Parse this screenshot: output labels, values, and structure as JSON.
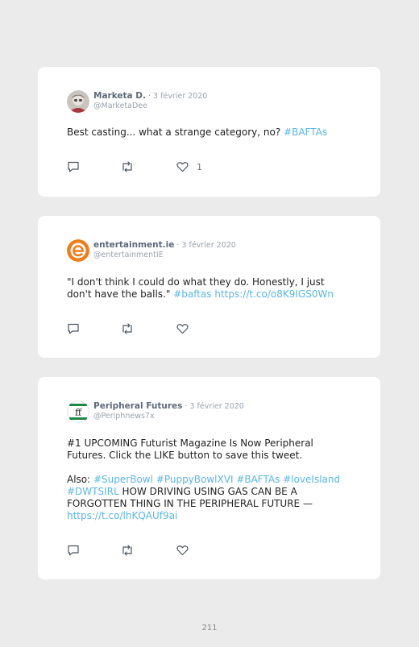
{
  "tweets": [
    {
      "name": "Marketa D.",
      "date": " · 3 février 2020",
      "handle": "@MarketaDee",
      "avatar_icon": "user-photo-avatar",
      "paragraphs": [
        [
          {
            "t": "Best casting... what a strange category, no? ",
            "link": false
          },
          {
            "t": "#BAFTAs",
            "link": true
          }
        ]
      ],
      "like_count": "1"
    },
    {
      "name": "entertainment.ie",
      "date": " · 3 février 2020",
      "handle": "@entertainmentIE",
      "avatar_icon": "entertainment-ie-logo",
      "paragraphs": [
        [
          {
            "t": "\"I don't think I could do what they do. Honestly, I just don't have the balls.\" ",
            "link": false
          },
          {
            "t": "#baftas",
            "link": true
          },
          {
            "t": " ",
            "link": false
          },
          {
            "t": "https://t.co/o8K9IGS0Wn",
            "link": true
          }
        ]
      ],
      "like_count": ""
    },
    {
      "name": "Peripheral Futures",
      "date": " · 3 février 2020",
      "handle": "@Periphnews7x",
      "avatar_icon": "peripheral-futures-logo",
      "paragraphs": [
        [
          {
            "t": "#1 UPCOMING Futurist Magazine Is Now Peripheral Futures. Click the LIKE button to save this tweet.",
            "link": false
          }
        ],
        [
          {
            "t": "Also: ",
            "link": false
          },
          {
            "t": "#SuperBowl",
            "link": true
          },
          {
            "t": " ",
            "link": false
          },
          {
            "t": "#PuppyBowlXVI",
            "link": true
          },
          {
            "t": " ",
            "link": false
          },
          {
            "t": "#BAFTAs",
            "link": true
          },
          {
            "t": " ",
            "link": false
          },
          {
            "t": "#loveIsland",
            "link": true
          },
          {
            "t": " ",
            "link": false
          },
          {
            "t": "#DWTSIRL",
            "link": true
          },
          {
            "t": " HOW DRIVING USING GAS CAN BE A FORGOTTEN THING IN THE PERIPHERAL FUTURE — ",
            "link": false
          },
          {
            "t": "https://t.co/lhKQAUf9ai",
            "link": true
          }
        ]
      ],
      "like_count": ""
    }
  ],
  "icons": {
    "reply": "reply-icon",
    "retweet": "retweet-icon",
    "like": "heart-icon"
  },
  "colors": {
    "link": "#5bb6e6",
    "name": "#5e6a7a",
    "meta": "#9aa3ad",
    "icon": "#4a5560"
  },
  "page_number": "211"
}
